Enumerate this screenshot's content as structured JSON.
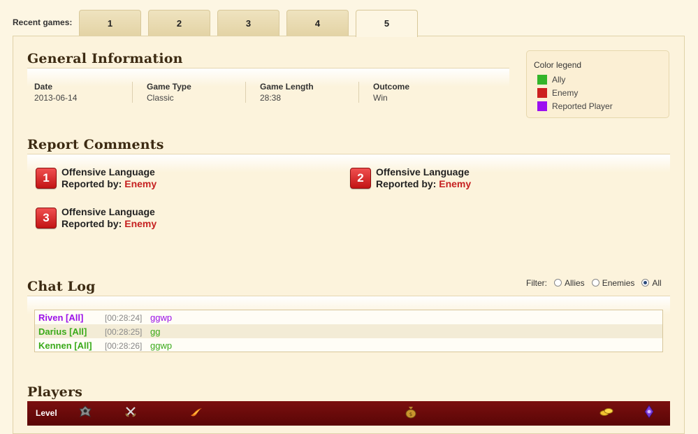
{
  "tabs": {
    "label": "Recent games:",
    "items": [
      "1",
      "2",
      "3",
      "4",
      "5"
    ],
    "active_index": 4
  },
  "general": {
    "title": "General Information",
    "fields": [
      {
        "label": "Date",
        "value": "2013-06-14"
      },
      {
        "label": "Game Type",
        "value": "Classic"
      },
      {
        "label": "Game Length",
        "value": "28:38"
      },
      {
        "label": "Outcome",
        "value": "Win"
      }
    ]
  },
  "legend": {
    "title": "Color legend",
    "items": [
      {
        "label": "Ally",
        "color": "#33b52a"
      },
      {
        "label": "Enemy",
        "color": "#cc2020"
      },
      {
        "label": "Reported Player",
        "color": "#9b10f0"
      }
    ]
  },
  "reports": {
    "title": "Report Comments",
    "items": [
      {
        "number": "1",
        "reason": "Offensive Language",
        "by_label": "Reported by:",
        "by": "Enemy"
      },
      {
        "number": "2",
        "reason": "Offensive Language",
        "by_label": "Reported by:",
        "by": "Enemy"
      },
      {
        "number": "3",
        "reason": "Offensive Language",
        "by_label": "Reported by:",
        "by": "Enemy"
      }
    ]
  },
  "chat": {
    "title": "Chat Log",
    "filter_label": "Filter:",
    "filters": [
      "Allies",
      "Enemies",
      "All"
    ],
    "selected_filter": "All",
    "lines": [
      {
        "name": "Riven [All]",
        "time": "[00:28:24]",
        "message": "ggwp",
        "team": "reported"
      },
      {
        "name": "Darius [All]",
        "time": "[00:28:25]",
        "message": "gg",
        "team": "ally"
      },
      {
        "name": "Kennen [All]",
        "time": "[00:28:26]",
        "message": "ggwp",
        "team": "ally"
      }
    ]
  },
  "players": {
    "title": "Players",
    "header": {
      "level_label": "Level",
      "icons": [
        "champion-icon",
        "kda-swords-icon",
        "spell-flame-icon",
        "gold-bag-icon",
        "gold-coins-icon",
        "ward-icon"
      ]
    }
  },
  "colors": {
    "ally": "#33b52a",
    "enemy": "#cc2020",
    "reported": "#9b10f0",
    "header_bar": "#6e0b0b"
  }
}
